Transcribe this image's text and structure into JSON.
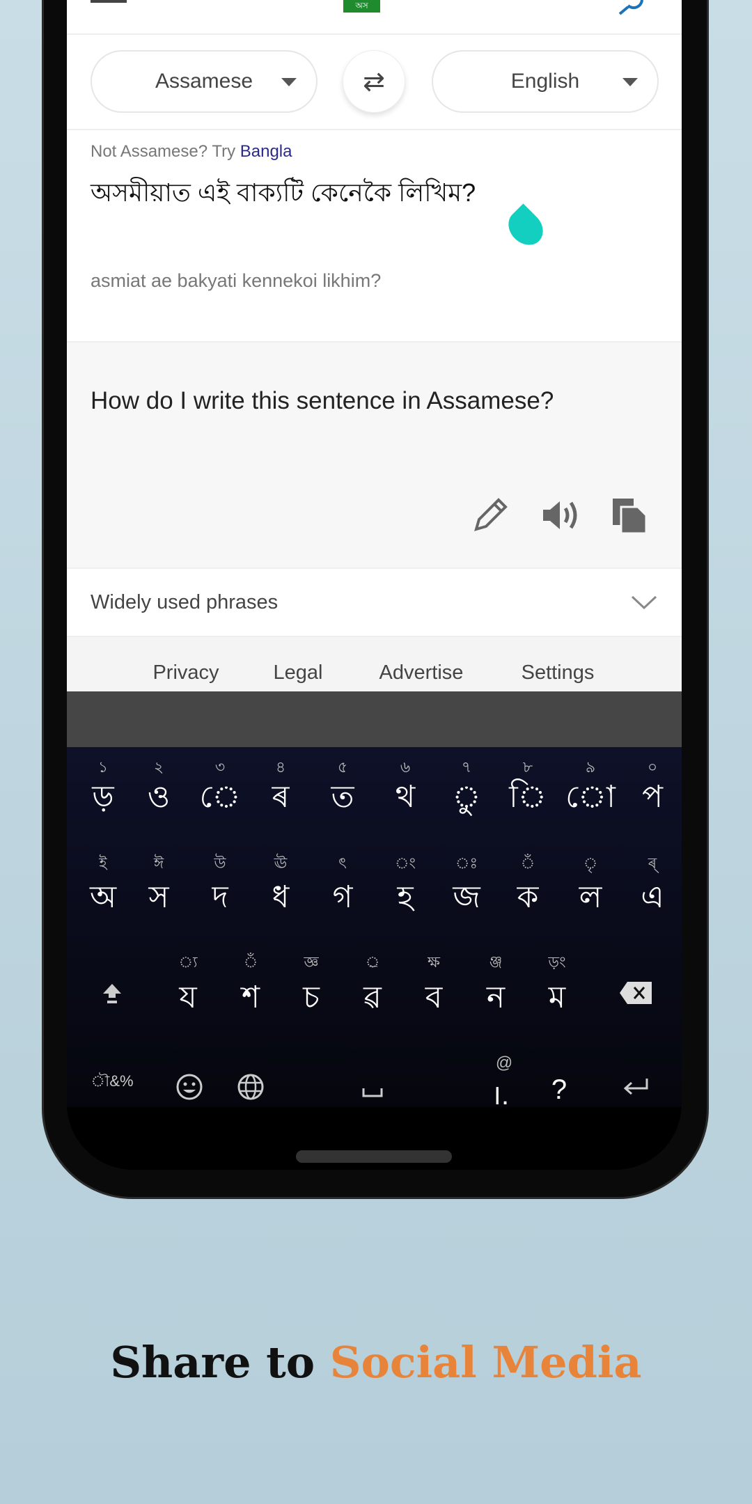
{
  "header": {
    "menu_icon": "hamburger-icon",
    "logo_text": "অস",
    "search_icon": "search-icon"
  },
  "languages": {
    "source": "Assamese",
    "target": "English",
    "swap_icon": "swap-arrows-icon"
  },
  "detect": {
    "prefix": "Not Assamese? Try",
    "link": "Bangla"
  },
  "input": {
    "text": "অসমীয়াত এই বাক্যটি কেনেকৈ লিখিম?",
    "romanization": "asmiat ae bakyati kennekoi likhim?"
  },
  "output": {
    "text": "How do I write this sentence in Assamese?",
    "actions": [
      "pencil-icon",
      "speaker-icon",
      "copy-icon"
    ]
  },
  "phrases": {
    "label": "Widely used phrases"
  },
  "footer": [
    "Privacy",
    "Legal",
    "Advertise",
    "Settings"
  ],
  "keyboard": {
    "row1": {
      "hints": [
        "১",
        "২",
        "৩",
        "৪",
        "৫",
        "৬",
        "৭",
        "৮",
        "৯",
        "০"
      ],
      "keys": [
        "ড়",
        "ও",
        "ে",
        "ৰ",
        "ত",
        "থ",
        "ু",
        "ি",
        "ো",
        "প"
      ]
    },
    "row2": {
      "hints": [
        "ই",
        "ঈ",
        "উ",
        "ঊ",
        "ৎ",
        "ং",
        "ঃ",
        "ঁ",
        "ৃ",
        "ৰ্"
      ],
      "keys": [
        "অ",
        "স",
        "দ",
        "ধ",
        "গ",
        "হ",
        "জ",
        "ক",
        "ল",
        "এ"
      ]
    },
    "row3": {
      "hints": [
        "্য",
        "ঁ",
        "জ্ঞ",
        "্র",
        "ক্ষ",
        "ঞ্জ",
        "ড়ং"
      ],
      "keys": [
        "য",
        "শ",
        "চ",
        "ৱ",
        "ব",
        "ন",
        "ম"
      ]
    },
    "row4": {
      "symbols": "ৗ&%",
      "period": "।.",
      "period_hint": "@",
      "question": "?"
    }
  },
  "caption": {
    "part1": "Share to ",
    "part2": "Social Media"
  },
  "colors": {
    "accent": "#e8833a",
    "link": "#2b2a8c",
    "teal": "#12cfc0",
    "keyboard_bg": "#0b0d1f",
    "logo": "#1e8c2e"
  }
}
